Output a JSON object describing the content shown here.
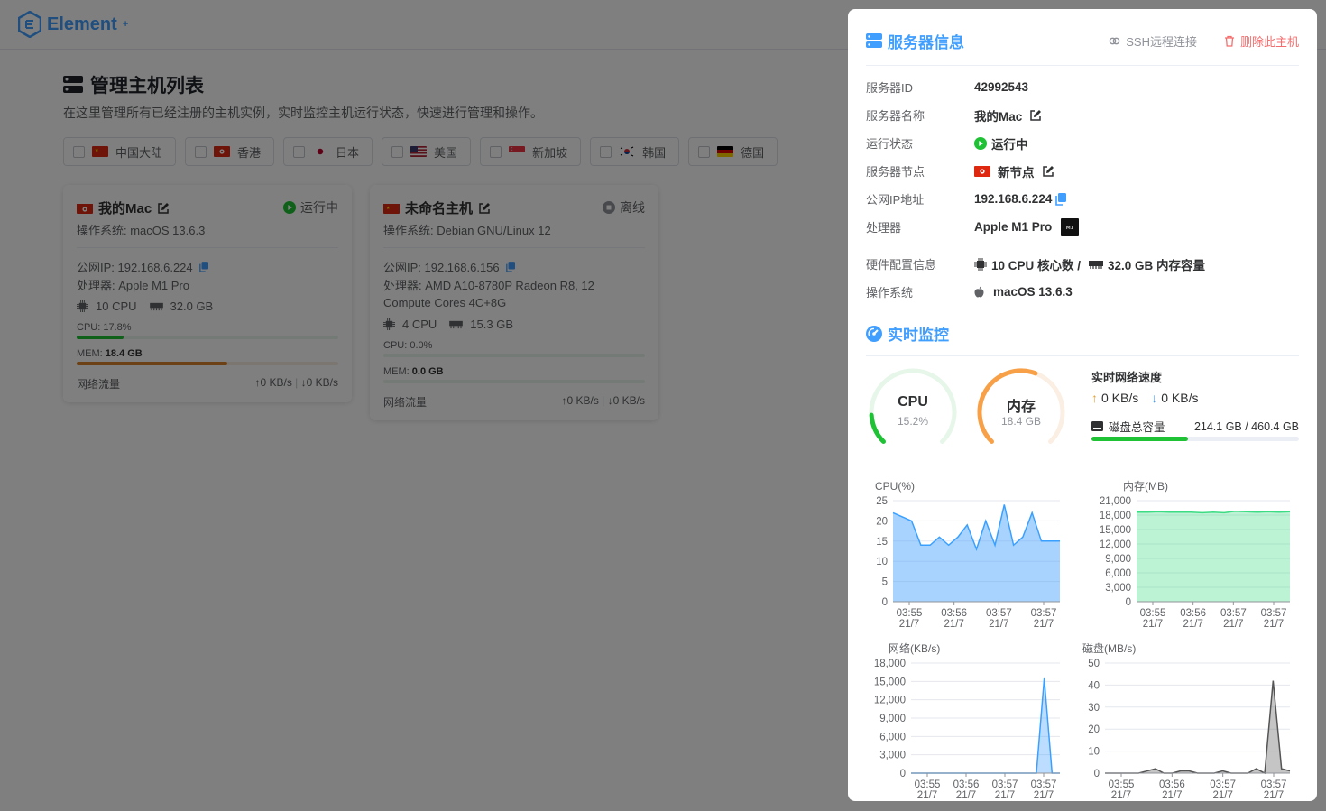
{
  "app": {
    "brand": "Element",
    "brand_sup": "+"
  },
  "page": {
    "title": "管理主机列表",
    "description": "在这里管理所有已经注册的主机实例，实时监控主机运行状态，快速进行管理和操作。"
  },
  "filters": [
    {
      "label": "中国大陆",
      "flag": "cn"
    },
    {
      "label": "香港",
      "flag": "hk"
    },
    {
      "label": "日本",
      "flag": "jp"
    },
    {
      "label": "美国",
      "flag": "us"
    },
    {
      "label": "新加坡",
      "flag": "sg"
    },
    {
      "label": "韩国",
      "flag": "kr"
    },
    {
      "label": "德国",
      "flag": "de"
    }
  ],
  "hosts": [
    {
      "name": "我的Mac",
      "status": "运行中",
      "status_color": "#1fc235",
      "os": "操作系统: macOS 13.6.3",
      "ip": "公网IP: 192.168.6.224",
      "cpu_model": "处理器:   Apple M1 Pro",
      "cpu": "10 CPU",
      "mem": "32.0 GB",
      "cpu_label": "CPU: 17.8%",
      "cpu_pct": 17.8,
      "mem_label_prefix": "MEM: ",
      "mem_value": "18.4 GB",
      "mem_pct": 57.5,
      "net_label": "网络流量",
      "up": "↑0 KB/s",
      "down": "↓0 KB/s"
    },
    {
      "name": "未命名主机",
      "status": "离线",
      "status_color": "#909399",
      "os": "操作系统: Debian GNU/Linux 12",
      "ip": "公网IP: 192.168.6.156",
      "cpu_model": "处理器:   AMD A10-8780P Radeon R8, 12 Compute Cores 4C+8G",
      "cpu": "4 CPU",
      "mem": "15.3 GB",
      "cpu_label": "CPU: 0.0%",
      "cpu_pct": 0,
      "mem_label_prefix": "MEM: ",
      "mem_value": "0.0 GB",
      "mem_pct": 0,
      "net_label": "网络流量",
      "up": "↑0 KB/s",
      "down": "↓0 KB/s"
    }
  ],
  "drawer": {
    "title": "服务器信息",
    "ssh": "SSH远程连接",
    "delete": "删除此主机",
    "fields": {
      "id_label": "服务器ID",
      "id": "42992543",
      "name_label": "服务器名称",
      "name": "我的Mac",
      "status_label": "运行状态",
      "status": "运行中",
      "node_label": "服务器节点",
      "node": "新节点",
      "ip_label": "公网IP地址",
      "ip": "192.168.6.224",
      "cpu_label": "处理器",
      "cpu": "Apple M1 Pro",
      "hw_label": "硬件配置信息",
      "hw_cpu": "10 CPU 核心数 /",
      "hw_mem": "32.0 GB 内存容量",
      "os_label": "操作系统",
      "os": "macOS 13.6.3"
    },
    "monitor_title": "实时监控",
    "gauge_cpu": {
      "label": "CPU",
      "value": "15.2%",
      "pct": 15.2
    },
    "gauge_mem": {
      "label": "内存",
      "value": "18.4 GB",
      "pct": 57.5
    },
    "net_title": "实时网络速度",
    "net_up": "0 KB/s",
    "net_down": "0 KB/s",
    "disk_label": "磁盘总容量",
    "disk_value": "214.1 GB / 460.4 GB",
    "disk_pct": 46.5
  },
  "chart_data": [
    {
      "type": "area",
      "title": "CPU(%)",
      "x": [
        "03:55",
        "03:56",
        "03:57",
        "03:57"
      ],
      "x_sub": "21/7",
      "ylim": [
        0,
        25
      ],
      "yticks": [
        "0",
        "5",
        "10",
        "15",
        "20",
        "25"
      ],
      "values": [
        22,
        21,
        20,
        14,
        14,
        16,
        14,
        16,
        19,
        13,
        20,
        14,
        24,
        14,
        16,
        22,
        15,
        15,
        15
      ],
      "color": "#3aa0ff",
      "fill": "rgba(64,158,255,0.45)"
    },
    {
      "type": "area",
      "title": "内存(MB)",
      "x": [
        "03:55",
        "03:56",
        "03:57",
        "03:57"
      ],
      "x_sub": "21/7",
      "ylim": [
        0,
        21000
      ],
      "yticks": [
        "0",
        "3,000",
        "6,000",
        "9,000",
        "12,000",
        "15,000",
        "18,000",
        "21,000"
      ],
      "values": [
        18600,
        18600,
        18700,
        18600,
        18600,
        18600,
        18500,
        18600,
        18500,
        18800,
        18700,
        18600,
        18700,
        18600,
        18700
      ],
      "color": "#3ddc84",
      "fill": "rgba(61,220,132,0.35)"
    },
    {
      "type": "area",
      "title": "网络(KB/s)",
      "x": [
        "03:55",
        "03:56",
        "03:57",
        "03:57"
      ],
      "x_sub": "21/7",
      "ylim": [
        0,
        18000
      ],
      "yticks": [
        "0",
        "3,000",
        "6,000",
        "9,000",
        "12,000",
        "15,000",
        "18,000"
      ],
      "values": [
        0,
        0,
        0,
        0,
        0,
        0,
        0,
        0,
        0,
        0,
        0,
        0,
        0,
        0,
        0,
        0,
        0,
        15500,
        0,
        0
      ],
      "color": "#3aa0ff",
      "fill": "rgba(64,158,255,0.35)"
    },
    {
      "type": "area",
      "title": "磁盘(MB/s)",
      "x": [
        "03:55",
        "03:56",
        "03:57",
        "03:57"
      ],
      "x_sub": "21/7",
      "ylim": [
        0,
        50
      ],
      "yticks": [
        "0",
        "10",
        "20",
        "30",
        "40",
        "50"
      ],
      "values": [
        0,
        0,
        0,
        0,
        0,
        1,
        2,
        0,
        0,
        1,
        1,
        0,
        0,
        0,
        1,
        0,
        0,
        0,
        2,
        0,
        42,
        2,
        1
      ],
      "color": "#555",
      "fill": "rgba(110,110,110,0.4)"
    }
  ]
}
